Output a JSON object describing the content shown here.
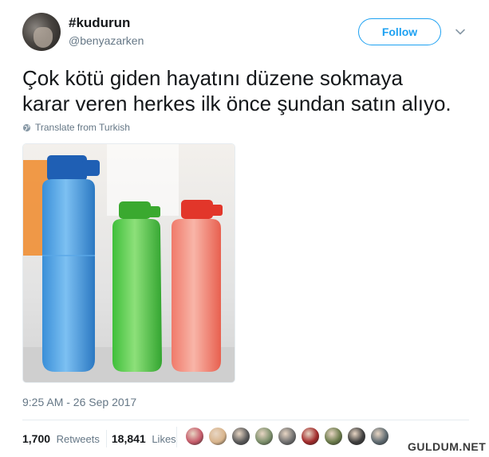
{
  "user": {
    "display_name": "#kudurun",
    "screen_name": "@benyazarken"
  },
  "follow_label": "Follow",
  "tweet": {
    "text_line1": "Çok kötü giden hayatını düzene sokmaya",
    "text_line2": "karar veren herkes ilk önce şundan satın alıyo.",
    "translate_label": "Translate from Turkish",
    "timestamp": "9:25 AM - 26 Sep 2017"
  },
  "stats": {
    "retweets_count": "1,700",
    "retweets_label": "Retweets",
    "likes_count": "18,841",
    "likes_label": "Likes"
  },
  "likers_colors": [
    "#c65b6a",
    "#d8b48c",
    "#5a5a5a",
    "#7c8f6b",
    "#6f6f6f",
    "#a12a2a",
    "#6a7a4a",
    "#3e3e3e",
    "#5e6a70"
  ],
  "watermark": "GULDUM.NET",
  "colors": {
    "accent": "#1da1f2",
    "text": "#14171a",
    "secondary": "#657786"
  }
}
